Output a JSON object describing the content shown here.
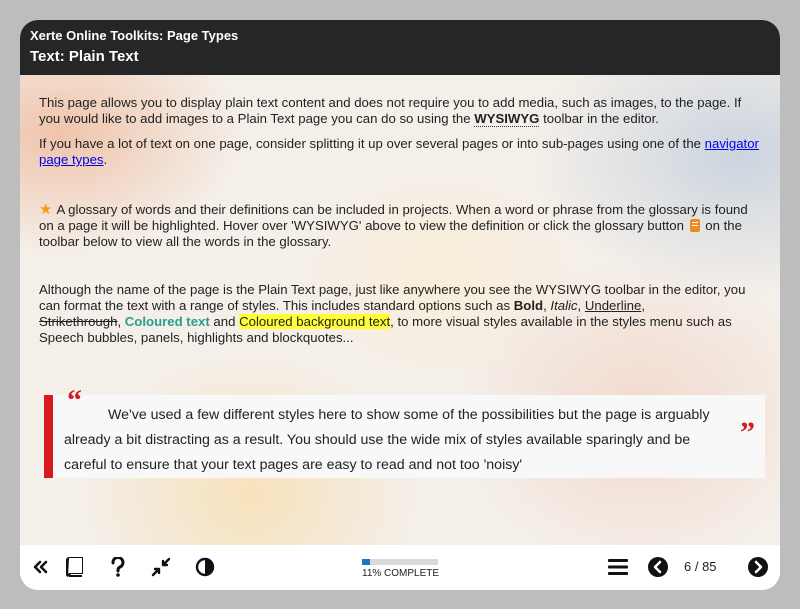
{
  "header": {
    "app_title": "Xerte Online Toolkits: Page Types",
    "page_title": "Text: Plain Text"
  },
  "content": {
    "p1_a": "This page allows you to display plain text content and does not require you to add media, such as images, to the page. If you would like to add images to a Plain Text page you can do so using the ",
    "p1_keyword": "WYSIWYG",
    "p1_b": " toolbar in the editor.",
    "p2_a": "If you have a lot of text on one page, consider splitting it up over several pages or into sub-pages using one of the ",
    "p2_link": "navigator page types",
    "p2_b": ".",
    "p3_a": "A glossary of words and their definitions can be included in projects. When a word or phrase from the glossary is found on a page it will be highlighted. Hover over 'WYSIWYG' above to view the definition or click the glossary button ",
    "p3_b": " on the toolbar below to view all the words in the glossary.",
    "p4_a": "Although the name of the page is the Plain Text page, just like anywhere you see the WYSIWYG toolbar in the editor, you can format the text with a range of styles. This includes standard options such as ",
    "p4_bold": "Bold",
    "p4_sep1": ", ",
    "p4_italic": "Italic",
    "p4_sep2": ", ",
    "p4_underline": "Underline",
    "p4_sep3": ",",
    "p4_strike": "Strikethrough",
    "p4_sep4": ", ",
    "p4_coloured": "Coloured text",
    "p4_and": " and ",
    "p4_bg": "Coloured background text",
    "p4_b": ", to more visual styles available in the styles menu such as Speech bubbles, panels, highlights and blockquotes...",
    "quote": "We've used a few different styles here to show some of the possibilities but the page is arguably already a bit distracting as a result. You should use the wide mix of styles available sparingly and be careful to ensure that your text pages are easy to read and not too 'noisy'",
    "quote_open": "“",
    "quote_close": "”"
  },
  "footer": {
    "progress_percent": 11,
    "progress_label": "11% COMPLETE",
    "page_count": "6 / 85"
  },
  "icons": {
    "glossary_inline": "glossary-book-icon",
    "star": "star-icon"
  },
  "colors": {
    "header_bg": "#262626",
    "quote_accent": "#d71920",
    "coloured_text": "#2a9d8f",
    "highlight": "#ffff33",
    "progress_fill": "#1a73c8"
  }
}
